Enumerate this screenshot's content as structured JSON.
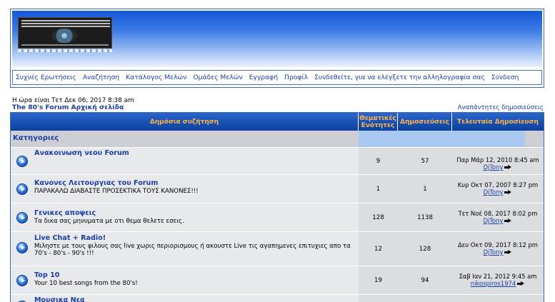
{
  "nav": {
    "items": [
      "Συχνές Ερωτήσεις",
      "Αναζήτηση",
      "Κατάλογος Μελών",
      "Ομάδες Μελών",
      "Εγγραφή",
      "Προφίλ",
      "Συνδεθείτε, για να ελέγξετε την αλληλογραφία σας",
      "Σύνδεση"
    ]
  },
  "info": {
    "time": "Η ώρα είναι Τετ Δεκ 06, 2017 8:38 am",
    "home": "The 80's Forum Αρχική σελίδα",
    "unanswered": "Αναπάντητες δημοσιεύσεις"
  },
  "table": {
    "headers": {
      "forum": "Δημόσια συζήτηση",
      "topics": "Θεματικές Ενότητες",
      "posts": "Δημοσιεύσεις",
      "last": "Τελευταία Δημοσίευση"
    },
    "category": "Κατηγοριες",
    "rows": [
      {
        "title": "Ανακοινωση νεου Forum",
        "desc": "",
        "topics": "9",
        "posts": "57",
        "last_date": "Παρ Μάρ 12, 2010 8:45 am",
        "last_user": "DjTony"
      },
      {
        "title": "Κανονες Λειτουργιας του Forum",
        "desc": "ΠΑΡΑΚΑΛΩ ΔΙΑΒΑΣΤΕ ΠΡΟΣΕΚΤΙΚΑ ΤΟΥΣ ΚΑΝΟΝΕΣ!!!",
        "topics": "1",
        "posts": "1",
        "last_date": "Κυρ Οκτ 07, 2007 8:27 pm",
        "last_user": "DjTony"
      },
      {
        "title": "Γενικες αποψεις",
        "desc": "Τα δικα σας μηνυματα με οτι θεμα θελετε εσεις.",
        "topics": "128",
        "posts": "1138",
        "last_date": "Τετ Νοέ 08, 2017 8:02 pm",
        "last_user": "DjTony"
      },
      {
        "title": "Live Chat + Radio!",
        "desc": "Μιληστε με τους φιλους σας live χωρις περιορισμους ή ακουστε Live τις αγαπημενες επιτυχιες απο τα 70's - 80's - 90's !!!",
        "topics": "12",
        "posts": "128",
        "last_date": "Δευ Οκτ 09, 2017 8:12 pm",
        "last_user": "DjTony"
      },
      {
        "title": "Top 10",
        "desc": "Your 10 best songs from the 80's!",
        "topics": "19",
        "posts": "94",
        "last_date": "Σαβ Ιαν 21, 2012 9:45 am",
        "last_user": "nikospiros1974"
      },
      {
        "title": "Μουσικα Νεα",
        "desc": "",
        "topics": "",
        "posts": "",
        "last_date": "",
        "last_user": ""
      }
    ]
  }
}
